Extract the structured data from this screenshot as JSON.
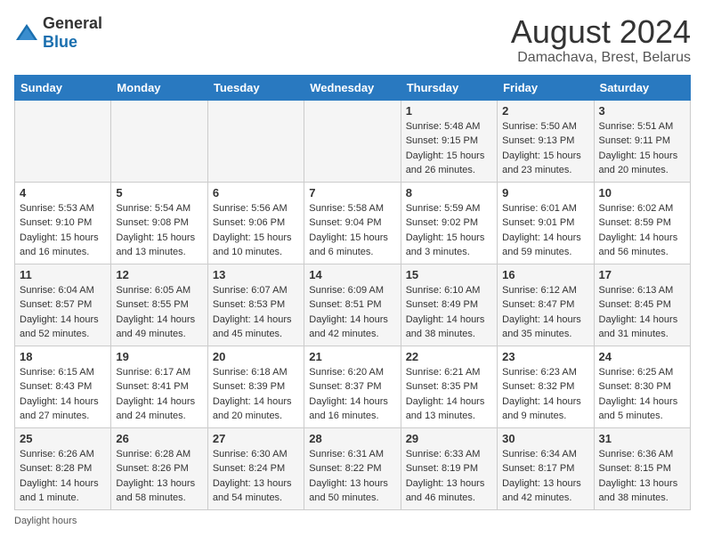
{
  "logo": {
    "general": "General",
    "blue": "Blue"
  },
  "title": "August 2024",
  "subtitle": "Damachava, Brest, Belarus",
  "weekdays": [
    "Sunday",
    "Monday",
    "Tuesday",
    "Wednesday",
    "Thursday",
    "Friday",
    "Saturday"
  ],
  "footer": "Daylight hours",
  "weeks": [
    [
      {
        "day": "",
        "sunrise": "",
        "sunset": "",
        "daylight": ""
      },
      {
        "day": "",
        "sunrise": "",
        "sunset": "",
        "daylight": ""
      },
      {
        "day": "",
        "sunrise": "",
        "sunset": "",
        "daylight": ""
      },
      {
        "day": "",
        "sunrise": "",
        "sunset": "",
        "daylight": ""
      },
      {
        "day": "1",
        "sunrise": "Sunrise: 5:48 AM",
        "sunset": "Sunset: 9:15 PM",
        "daylight": "Daylight: 15 hours and 26 minutes."
      },
      {
        "day": "2",
        "sunrise": "Sunrise: 5:50 AM",
        "sunset": "Sunset: 9:13 PM",
        "daylight": "Daylight: 15 hours and 23 minutes."
      },
      {
        "day": "3",
        "sunrise": "Sunrise: 5:51 AM",
        "sunset": "Sunset: 9:11 PM",
        "daylight": "Daylight: 15 hours and 20 minutes."
      }
    ],
    [
      {
        "day": "4",
        "sunrise": "Sunrise: 5:53 AM",
        "sunset": "Sunset: 9:10 PM",
        "daylight": "Daylight: 15 hours and 16 minutes."
      },
      {
        "day": "5",
        "sunrise": "Sunrise: 5:54 AM",
        "sunset": "Sunset: 9:08 PM",
        "daylight": "Daylight: 15 hours and 13 minutes."
      },
      {
        "day": "6",
        "sunrise": "Sunrise: 5:56 AM",
        "sunset": "Sunset: 9:06 PM",
        "daylight": "Daylight: 15 hours and 10 minutes."
      },
      {
        "day": "7",
        "sunrise": "Sunrise: 5:58 AM",
        "sunset": "Sunset: 9:04 PM",
        "daylight": "Daylight: 15 hours and 6 minutes."
      },
      {
        "day": "8",
        "sunrise": "Sunrise: 5:59 AM",
        "sunset": "Sunset: 9:02 PM",
        "daylight": "Daylight: 15 hours and 3 minutes."
      },
      {
        "day": "9",
        "sunrise": "Sunrise: 6:01 AM",
        "sunset": "Sunset: 9:01 PM",
        "daylight": "Daylight: 14 hours and 59 minutes."
      },
      {
        "day": "10",
        "sunrise": "Sunrise: 6:02 AM",
        "sunset": "Sunset: 8:59 PM",
        "daylight": "Daylight: 14 hours and 56 minutes."
      }
    ],
    [
      {
        "day": "11",
        "sunrise": "Sunrise: 6:04 AM",
        "sunset": "Sunset: 8:57 PM",
        "daylight": "Daylight: 14 hours and 52 minutes."
      },
      {
        "day": "12",
        "sunrise": "Sunrise: 6:05 AM",
        "sunset": "Sunset: 8:55 PM",
        "daylight": "Daylight: 14 hours and 49 minutes."
      },
      {
        "day": "13",
        "sunrise": "Sunrise: 6:07 AM",
        "sunset": "Sunset: 8:53 PM",
        "daylight": "Daylight: 14 hours and 45 minutes."
      },
      {
        "day": "14",
        "sunrise": "Sunrise: 6:09 AM",
        "sunset": "Sunset: 8:51 PM",
        "daylight": "Daylight: 14 hours and 42 minutes."
      },
      {
        "day": "15",
        "sunrise": "Sunrise: 6:10 AM",
        "sunset": "Sunset: 8:49 PM",
        "daylight": "Daylight: 14 hours and 38 minutes."
      },
      {
        "day": "16",
        "sunrise": "Sunrise: 6:12 AM",
        "sunset": "Sunset: 8:47 PM",
        "daylight": "Daylight: 14 hours and 35 minutes."
      },
      {
        "day": "17",
        "sunrise": "Sunrise: 6:13 AM",
        "sunset": "Sunset: 8:45 PM",
        "daylight": "Daylight: 14 hours and 31 minutes."
      }
    ],
    [
      {
        "day": "18",
        "sunrise": "Sunrise: 6:15 AM",
        "sunset": "Sunset: 8:43 PM",
        "daylight": "Daylight: 14 hours and 27 minutes."
      },
      {
        "day": "19",
        "sunrise": "Sunrise: 6:17 AM",
        "sunset": "Sunset: 8:41 PM",
        "daylight": "Daylight: 14 hours and 24 minutes."
      },
      {
        "day": "20",
        "sunrise": "Sunrise: 6:18 AM",
        "sunset": "Sunset: 8:39 PM",
        "daylight": "Daylight: 14 hours and 20 minutes."
      },
      {
        "day": "21",
        "sunrise": "Sunrise: 6:20 AM",
        "sunset": "Sunset: 8:37 PM",
        "daylight": "Daylight: 14 hours and 16 minutes."
      },
      {
        "day": "22",
        "sunrise": "Sunrise: 6:21 AM",
        "sunset": "Sunset: 8:35 PM",
        "daylight": "Daylight: 14 hours and 13 minutes."
      },
      {
        "day": "23",
        "sunrise": "Sunrise: 6:23 AM",
        "sunset": "Sunset: 8:32 PM",
        "daylight": "Daylight: 14 hours and 9 minutes."
      },
      {
        "day": "24",
        "sunrise": "Sunrise: 6:25 AM",
        "sunset": "Sunset: 8:30 PM",
        "daylight": "Daylight: 14 hours and 5 minutes."
      }
    ],
    [
      {
        "day": "25",
        "sunrise": "Sunrise: 6:26 AM",
        "sunset": "Sunset: 8:28 PM",
        "daylight": "Daylight: 14 hours and 1 minute."
      },
      {
        "day": "26",
        "sunrise": "Sunrise: 6:28 AM",
        "sunset": "Sunset: 8:26 PM",
        "daylight": "Daylight: 13 hours and 58 minutes."
      },
      {
        "day": "27",
        "sunrise": "Sunrise: 6:30 AM",
        "sunset": "Sunset: 8:24 PM",
        "daylight": "Daylight: 13 hours and 54 minutes."
      },
      {
        "day": "28",
        "sunrise": "Sunrise: 6:31 AM",
        "sunset": "Sunset: 8:22 PM",
        "daylight": "Daylight: 13 hours and 50 minutes."
      },
      {
        "day": "29",
        "sunrise": "Sunrise: 6:33 AM",
        "sunset": "Sunset: 8:19 PM",
        "daylight": "Daylight: 13 hours and 46 minutes."
      },
      {
        "day": "30",
        "sunrise": "Sunrise: 6:34 AM",
        "sunset": "Sunset: 8:17 PM",
        "daylight": "Daylight: 13 hours and 42 minutes."
      },
      {
        "day": "31",
        "sunrise": "Sunrise: 6:36 AM",
        "sunset": "Sunset: 8:15 PM",
        "daylight": "Daylight: 13 hours and 38 minutes."
      }
    ]
  ]
}
